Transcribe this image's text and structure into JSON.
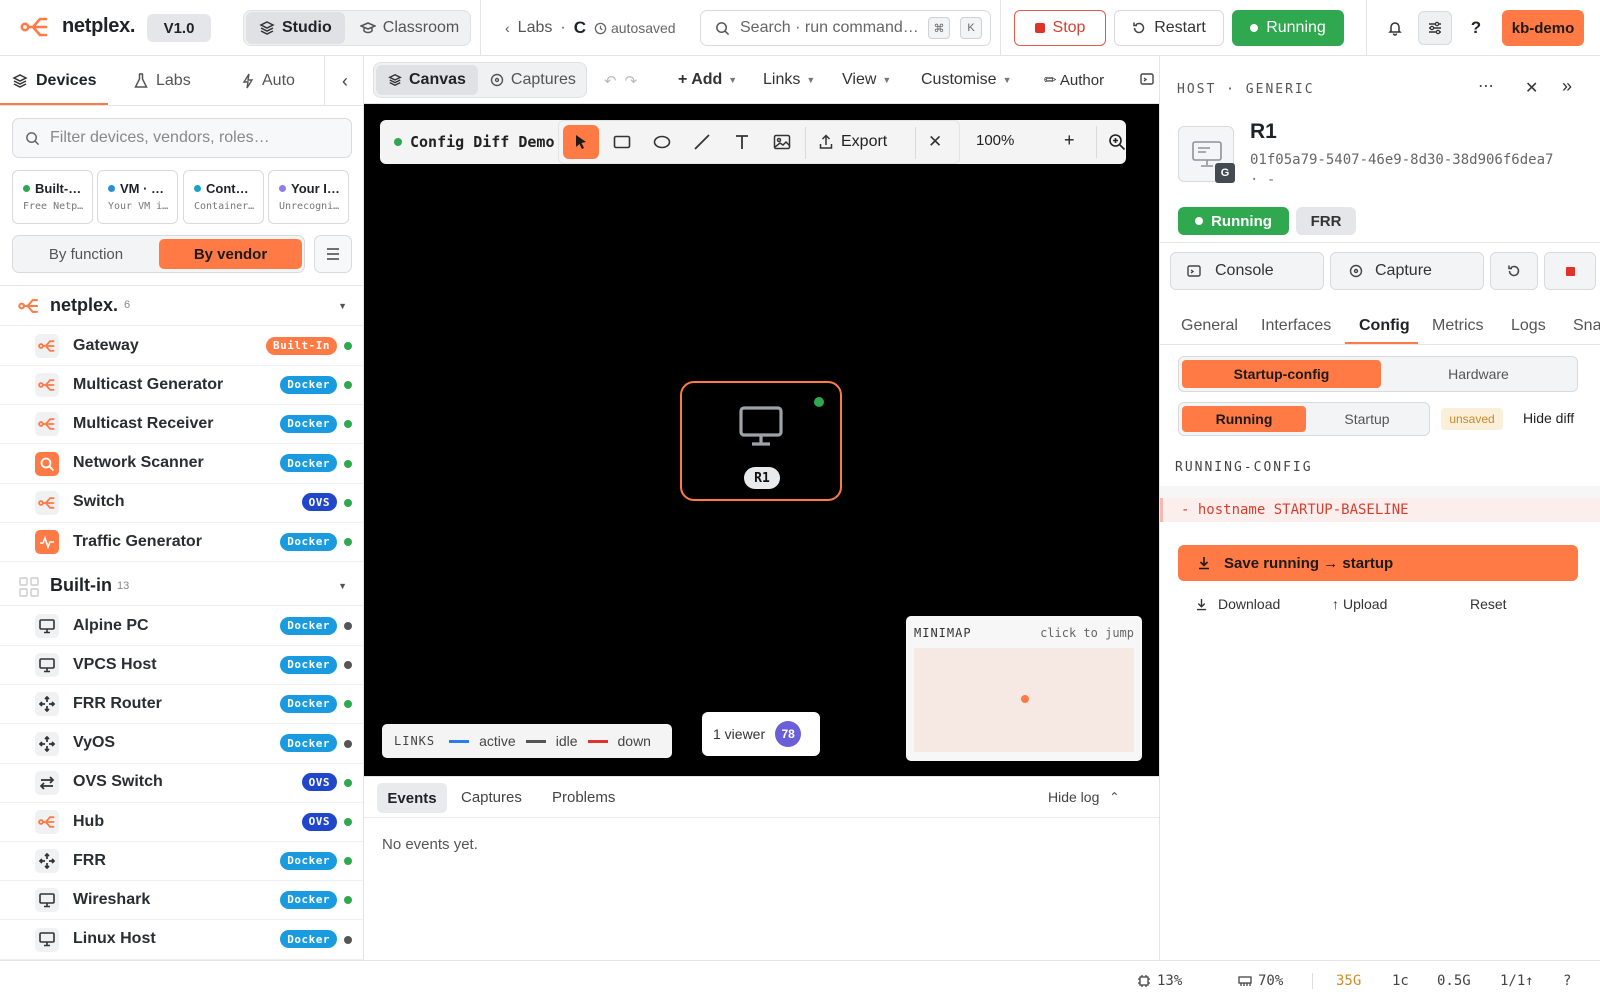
{
  "app": {
    "name": "netplex.",
    "version": "V1.0"
  },
  "modes": [
    {
      "label": "Studio",
      "active": true
    },
    {
      "label": "Classroom",
      "active": false
    }
  ],
  "breadcrumb": {
    "parent": "Labs",
    "sep": "·",
    "current": "C",
    "status": "autosaved"
  },
  "search": {
    "placeholder": "Search · run command…",
    "key1": "⌘",
    "key2": "K"
  },
  "lab_controls": {
    "stop": "Stop",
    "restart": "Restart",
    "running": "Running"
  },
  "user": {
    "label": "kb-demo"
  },
  "sidebar": {
    "tabs": [
      "Devices",
      "Labs",
      "Auto"
    ],
    "filter_placeholder": "Filter devices, vendors, roles…",
    "chips": [
      {
        "title": "Built-…",
        "sub": "Free Netp…",
        "dot": "#2fa84f"
      },
      {
        "title": "VM · …",
        "sub": "Your VM i…",
        "dot": "#2b8fd6"
      },
      {
        "title": "Cont…",
        "sub": "Container…",
        "dot": "#1aa3c9"
      },
      {
        "title": "Your I…",
        "sub": "Unrecogni…",
        "dot": "#8a7ef0"
      }
    ],
    "group_toggle": {
      "by_function": "By function",
      "by_vendor": "By vendor"
    },
    "groups": [
      {
        "name": "netplex.",
        "count": "6"
      },
      {
        "name": "Built-in",
        "count": "13"
      }
    ],
    "netplex_items": [
      {
        "name": "Gateway",
        "badge": "Built-In",
        "icon": "netplex-logo-icon"
      },
      {
        "name": "Multicast Generator",
        "badge": "Docker",
        "icon": "netplex-logo-icon"
      },
      {
        "name": "Multicast Receiver",
        "badge": "Docker",
        "icon": "netplex-logo-icon"
      },
      {
        "name": "Network Scanner",
        "badge": "Docker",
        "icon": "scanner-icon"
      },
      {
        "name": "Switch",
        "badge": "OVS",
        "icon": "netplex-logo-icon"
      },
      {
        "name": "Traffic Generator",
        "badge": "Docker",
        "icon": "traffic-icon"
      }
    ],
    "builtin_items": [
      {
        "name": "Alpine PC",
        "badge": "Docker",
        "icon": "monitor-icon",
        "status": "idle"
      },
      {
        "name": "VPCS Host",
        "badge": "Docker",
        "icon": "monitor-icon",
        "status": "idle"
      },
      {
        "name": "FRR Router",
        "badge": "Docker",
        "icon": "router-icon",
        "status": "ok"
      },
      {
        "name": "VyOS",
        "badge": "Docker",
        "icon": "router-icon",
        "status": "idle"
      },
      {
        "name": "OVS Switch",
        "badge": "OVS",
        "icon": "switch-icon",
        "status": "ok"
      },
      {
        "name": "Hub",
        "badge": "OVS",
        "icon": "netplex-logo-icon",
        "status": "ok"
      },
      {
        "name": "FRR",
        "badge": "Docker",
        "icon": "router-icon",
        "status": "ok"
      },
      {
        "name": "Wireshark",
        "badge": "Docker",
        "icon": "monitor-icon",
        "status": "ok"
      },
      {
        "name": "Linux Host",
        "badge": "Docker",
        "icon": "monitor-icon",
        "status": "idle"
      }
    ]
  },
  "canvas_toolbar": {
    "tabs": [
      "Canvas",
      "Captures"
    ],
    "menus": [
      "+ Add",
      "Links",
      "View",
      "Customise"
    ],
    "author": "✏ Author"
  },
  "canvas": {
    "lab_name": "Config Diff Demo",
    "export": "Export",
    "zoom": "100%",
    "node_label": "R1",
    "legend": {
      "title": "LINKS",
      "items": [
        "active",
        "idle",
        "down"
      ]
    },
    "viewers": {
      "label": "1 viewer",
      "badge": "78"
    },
    "minimap": {
      "title": "MINIMAP",
      "hint": "click to jump"
    }
  },
  "log": {
    "tabs": [
      "Events",
      "Captures",
      "Problems"
    ],
    "hide": "Hide log",
    "empty": "No events yet."
  },
  "panel": {
    "kind": "HOST · GENERIC",
    "name": "R1",
    "uuid": "01f05a79-5407-46e9-8d30-38d906f6dea7",
    "uuid_tail": "· -",
    "tile_badge": "G",
    "status": "Running",
    "image_tag": "FRR",
    "actions": {
      "console": "Console",
      "capture": "Capture"
    },
    "tabs": [
      "General",
      "Interfaces",
      "Config",
      "Metrics",
      "Logs",
      "Snap"
    ],
    "active_tab": "Config",
    "config_kind": {
      "a": "Startup-config",
      "b": "Hardware"
    },
    "compare": {
      "a": "Running",
      "b": "Startup",
      "unsaved": "unsaved",
      "hide_diff": "Hide diff"
    },
    "section": "RUNNING-CONFIG",
    "diff_line": "- hostname STARTUP-BASELINE",
    "save": "Save running → startup",
    "download": "Download",
    "upload": "Upload",
    "reset": "Reset"
  },
  "status": {
    "cpu": "13%",
    "mem": "70%",
    "disk": "35G",
    "cores": "1c",
    "swap": "0.5G",
    "net": "1/1↑",
    "help": "?"
  },
  "colors": {
    "accent": "#ff7a45",
    "running": "#2fa84f",
    "docker": "#1a9be0",
    "ovs": "#2047c9",
    "builtin": "#ff7a45"
  }
}
